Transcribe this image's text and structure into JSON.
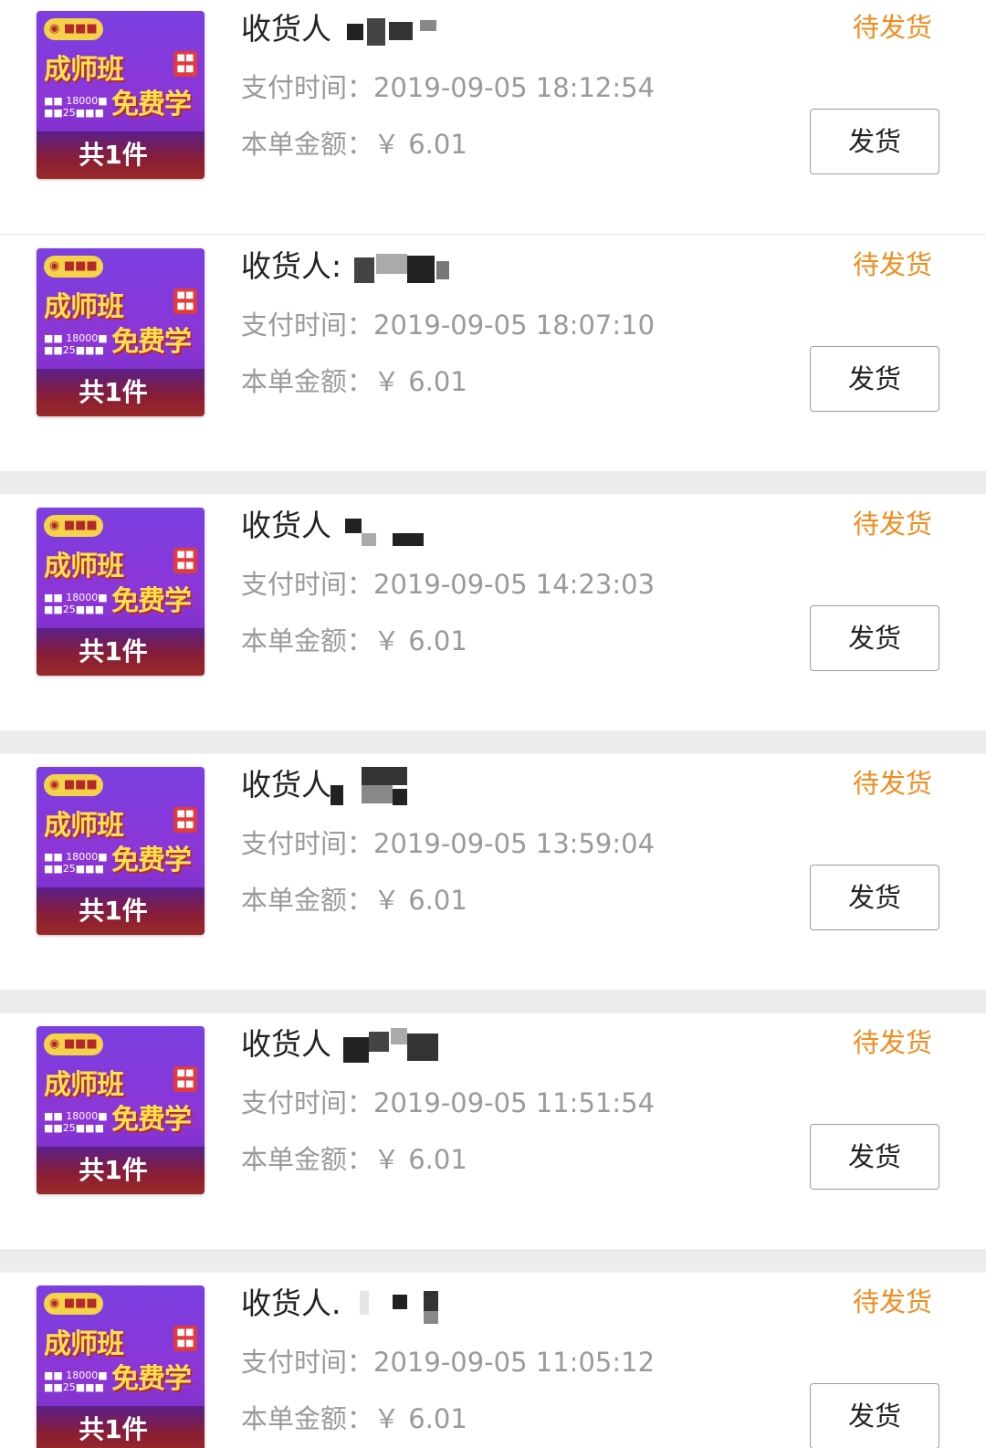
{
  "orders": [
    {
      "recipient": "收货人",
      "pay_time_label": "支付时间：",
      "pay_time": "2019-09-05 18:12:54",
      "amount_label": "本单金额：",
      "amount": "￥ 6.01",
      "status": "待发货",
      "ship_label": "发货",
      "item_count": "共1件",
      "thumbnail_title": "成师班",
      "thumbnail_subtitle": "免费学"
    },
    {
      "recipient": "收货人:",
      "pay_time_label": "支付时间：",
      "pay_time": "2019-09-05 18:07:10",
      "amount_label": "本单金额：",
      "amount": "￥ 6.01",
      "status": "待发货",
      "ship_label": "发货",
      "item_count": "共1件",
      "thumbnail_title": "成师班",
      "thumbnail_subtitle": "免费学"
    },
    {
      "recipient": "收货人",
      "pay_time_label": "支付时间：",
      "pay_time": "2019-09-05 14:23:03",
      "amount_label": "本单金额：",
      "amount": "￥ 6.01",
      "status": "待发货",
      "ship_label": "发货",
      "item_count": "共1件",
      "thumbnail_title": "成师班",
      "thumbnail_subtitle": "免费学"
    },
    {
      "recipient": "收货人",
      "pay_time_label": "支付时间：",
      "pay_time": "2019-09-05 13:59:04",
      "amount_label": "本单金额：",
      "amount": "￥ 6.01",
      "status": "待发货",
      "ship_label": "发货",
      "item_count": "共1件",
      "thumbnail_title": "成师班",
      "thumbnail_subtitle": "免费学"
    },
    {
      "recipient": "收货人",
      "pay_time_label": "支付时间：",
      "pay_time": "2019-09-05 11:51:54",
      "amount_label": "本单金额：",
      "amount": "￥ 6.01",
      "status": "待发货",
      "ship_label": "发货",
      "item_count": "共1件",
      "thumbnail_title": "成师班",
      "thumbnail_subtitle": "免费学"
    },
    {
      "recipient": "收货人.",
      "pay_time_label": "支付时间：",
      "pay_time": "2019-09-05 11:05:12",
      "amount_label": "本单金额：",
      "amount": "￥ 6.01",
      "status": "待发货",
      "ship_label": "发货",
      "item_count": "共1件",
      "thumbnail_title": "成师班",
      "thumbnail_subtitle": "免费学"
    }
  ],
  "colors": {
    "status_orange": "#f08c1e",
    "meta_gray": "#9a9a9a",
    "text_dark": "#222222",
    "thumb_purple": "#7b3fe0",
    "thumb_yellow": "#ffe14d",
    "divider": "#ececec"
  }
}
